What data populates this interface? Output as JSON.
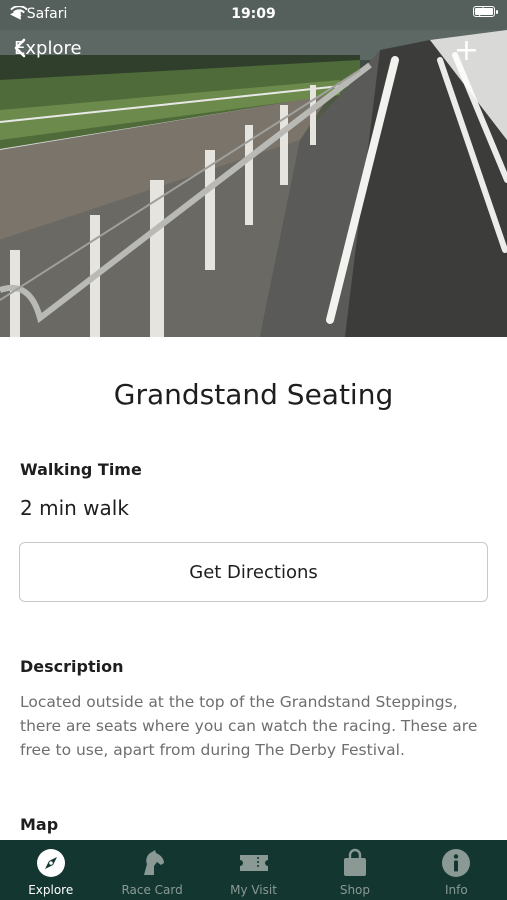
{
  "status_bar": {
    "carrier": "Safari",
    "time": "19:09"
  },
  "nav": {
    "back_label": "Explore",
    "add_label": "+"
  },
  "page": {
    "title": "Grandstand Seating",
    "walking_time_label": "Walking Time",
    "walking_time_value": "2 min walk",
    "directions_button": "Get Directions",
    "description_label": "Description",
    "description_text": "Located outside at the top of the Grandstand Steppings, there are seats where you can watch the racing. These are free to use, apart from during The Derby Festival.",
    "map_label": "Map"
  },
  "tab_bar": {
    "tabs": [
      {
        "label": "Explore",
        "icon": "compass-icon",
        "active": true
      },
      {
        "label": "Race Card",
        "icon": "horse-head-icon",
        "active": false
      },
      {
        "label": "My Visit",
        "icon": "ticket-icon",
        "active": false
      },
      {
        "label": "Shop",
        "icon": "shopping-bag-icon",
        "active": false
      },
      {
        "label": "Info",
        "icon": "info-icon",
        "active": false
      }
    ]
  },
  "colors": {
    "tab_bar_bg": "#133630",
    "tab_active": "#ffffff",
    "tab_inactive": "#8a9994",
    "body_text": "#6e6e6e"
  }
}
